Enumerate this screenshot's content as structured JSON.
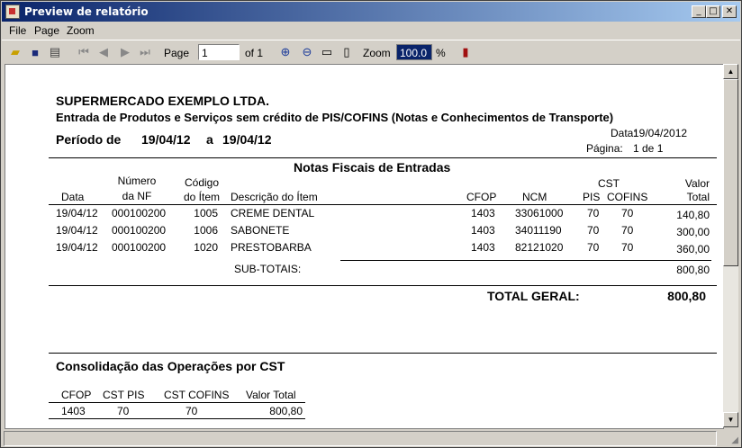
{
  "window": {
    "title": "Preview de relatório"
  },
  "menu": [
    "File",
    "Page",
    "Zoom"
  ],
  "toolbar": {
    "page_label": "Page",
    "page_value": "1",
    "of_pages": "of 1",
    "zoom_label": "Zoom",
    "zoom_value": "100.0",
    "percent": "%"
  },
  "report": {
    "company": "SUPERMERCADO EXEMPLO LTDA.",
    "subtitle": "Entrada de Produtos e Serviços sem crédito de PIS/COFINS (Notas e Conhecimentos de Transporte)",
    "period_label": "Período de",
    "period_from": "19/04/12",
    "period_sep": "a",
    "period_to": "19/04/12",
    "date_label": "Data:",
    "date_value": "19/04/2012",
    "page_label": "Página:",
    "page_value": "1 de 1",
    "section_title": "Notas Fiscais de Entradas",
    "headers": {
      "data": "Data",
      "numero": "Número",
      "numero2": "da NF",
      "codigo": "Código",
      "codigo2": "do Ítem",
      "descricao": "Descrição do Ítem",
      "cfop": "CFOP",
      "ncm": "NCM",
      "cst": "CST",
      "pis": "PIS",
      "cofins": "COFINS",
      "valor": "Valor",
      "valor2": "Total"
    },
    "rows": [
      {
        "data": "19/04/12",
        "nf": "000100200",
        "codigo": "1005",
        "descricao": "CREME DENTAL",
        "cfop": "1403",
        "ncm": "33061000",
        "pis": "70",
        "cofins": "70",
        "valor": "140,80"
      },
      {
        "data": "19/04/12",
        "nf": "000100200",
        "codigo": "1006",
        "descricao": "SABONETE",
        "cfop": "1403",
        "ncm": "34011190",
        "pis": "70",
        "cofins": "70",
        "valor": "300,00"
      },
      {
        "data": "19/04/12",
        "nf": "000100200",
        "codigo": "1020",
        "descricao": "PRESTOBARBA",
        "cfop": "1403",
        "ncm": "82121020",
        "pis": "70",
        "cofins": "70",
        "valor": "360,00"
      }
    ],
    "subtotal_label": "SUB-TOTAIS:",
    "subtotal_value": "800,80",
    "total_label": "TOTAL GERAL:",
    "total_value": "800,80",
    "consolidation_title": "Consolidação das Operações por CST",
    "cons_headers": {
      "cfop": "CFOP",
      "cst_pis": "CST PIS",
      "cst_cofins": "CST  COFINS",
      "valor_total": "Valor  Total"
    },
    "cons_rows": [
      {
        "cfop": "1403",
        "cst_pis": "70",
        "cst_cofins": "70",
        "valor_total": "800,80"
      }
    ]
  }
}
